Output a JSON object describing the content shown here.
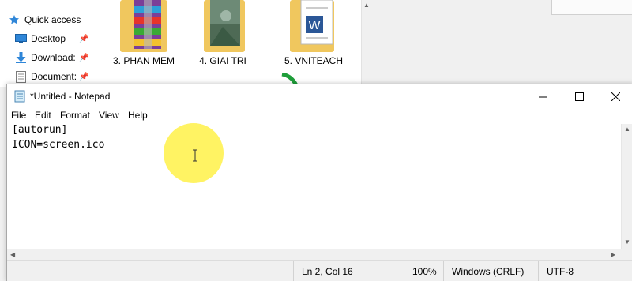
{
  "explorer": {
    "nav": [
      {
        "label": "Quick access",
        "icon": "star-icon",
        "pinned": false
      },
      {
        "label": "Desktop",
        "icon": "desktop-icon",
        "pinned": true
      },
      {
        "label": "Download:",
        "icon": "download-arrow-icon",
        "pinned": true
      },
      {
        "label": "Document:",
        "icon": "document-icon",
        "pinned": true
      }
    ],
    "folders": [
      {
        "label": "3. PHAN MEM",
        "icon": "winrar-folder-icon"
      },
      {
        "label": "4. GIAI TRI",
        "icon": "picture-folder-icon"
      },
      {
        "label": "5. VNITEACH",
        "icon": "word-document-folder-icon"
      }
    ]
  },
  "notepad": {
    "title": "*Untitled - Notepad",
    "menu": [
      "File",
      "Edit",
      "Format",
      "View",
      "Help"
    ],
    "content": [
      "[autorun]",
      "ICON=screen.ico"
    ],
    "status": {
      "position": "Ln 2, Col 16",
      "zoom": "100%",
      "line_ending": "Windows (CRLF)",
      "encoding": "UTF-8"
    }
  },
  "colors": {
    "highlight": "#ffee33",
    "folder": "#f0c75e",
    "accent_blue": "#1e78d2"
  }
}
